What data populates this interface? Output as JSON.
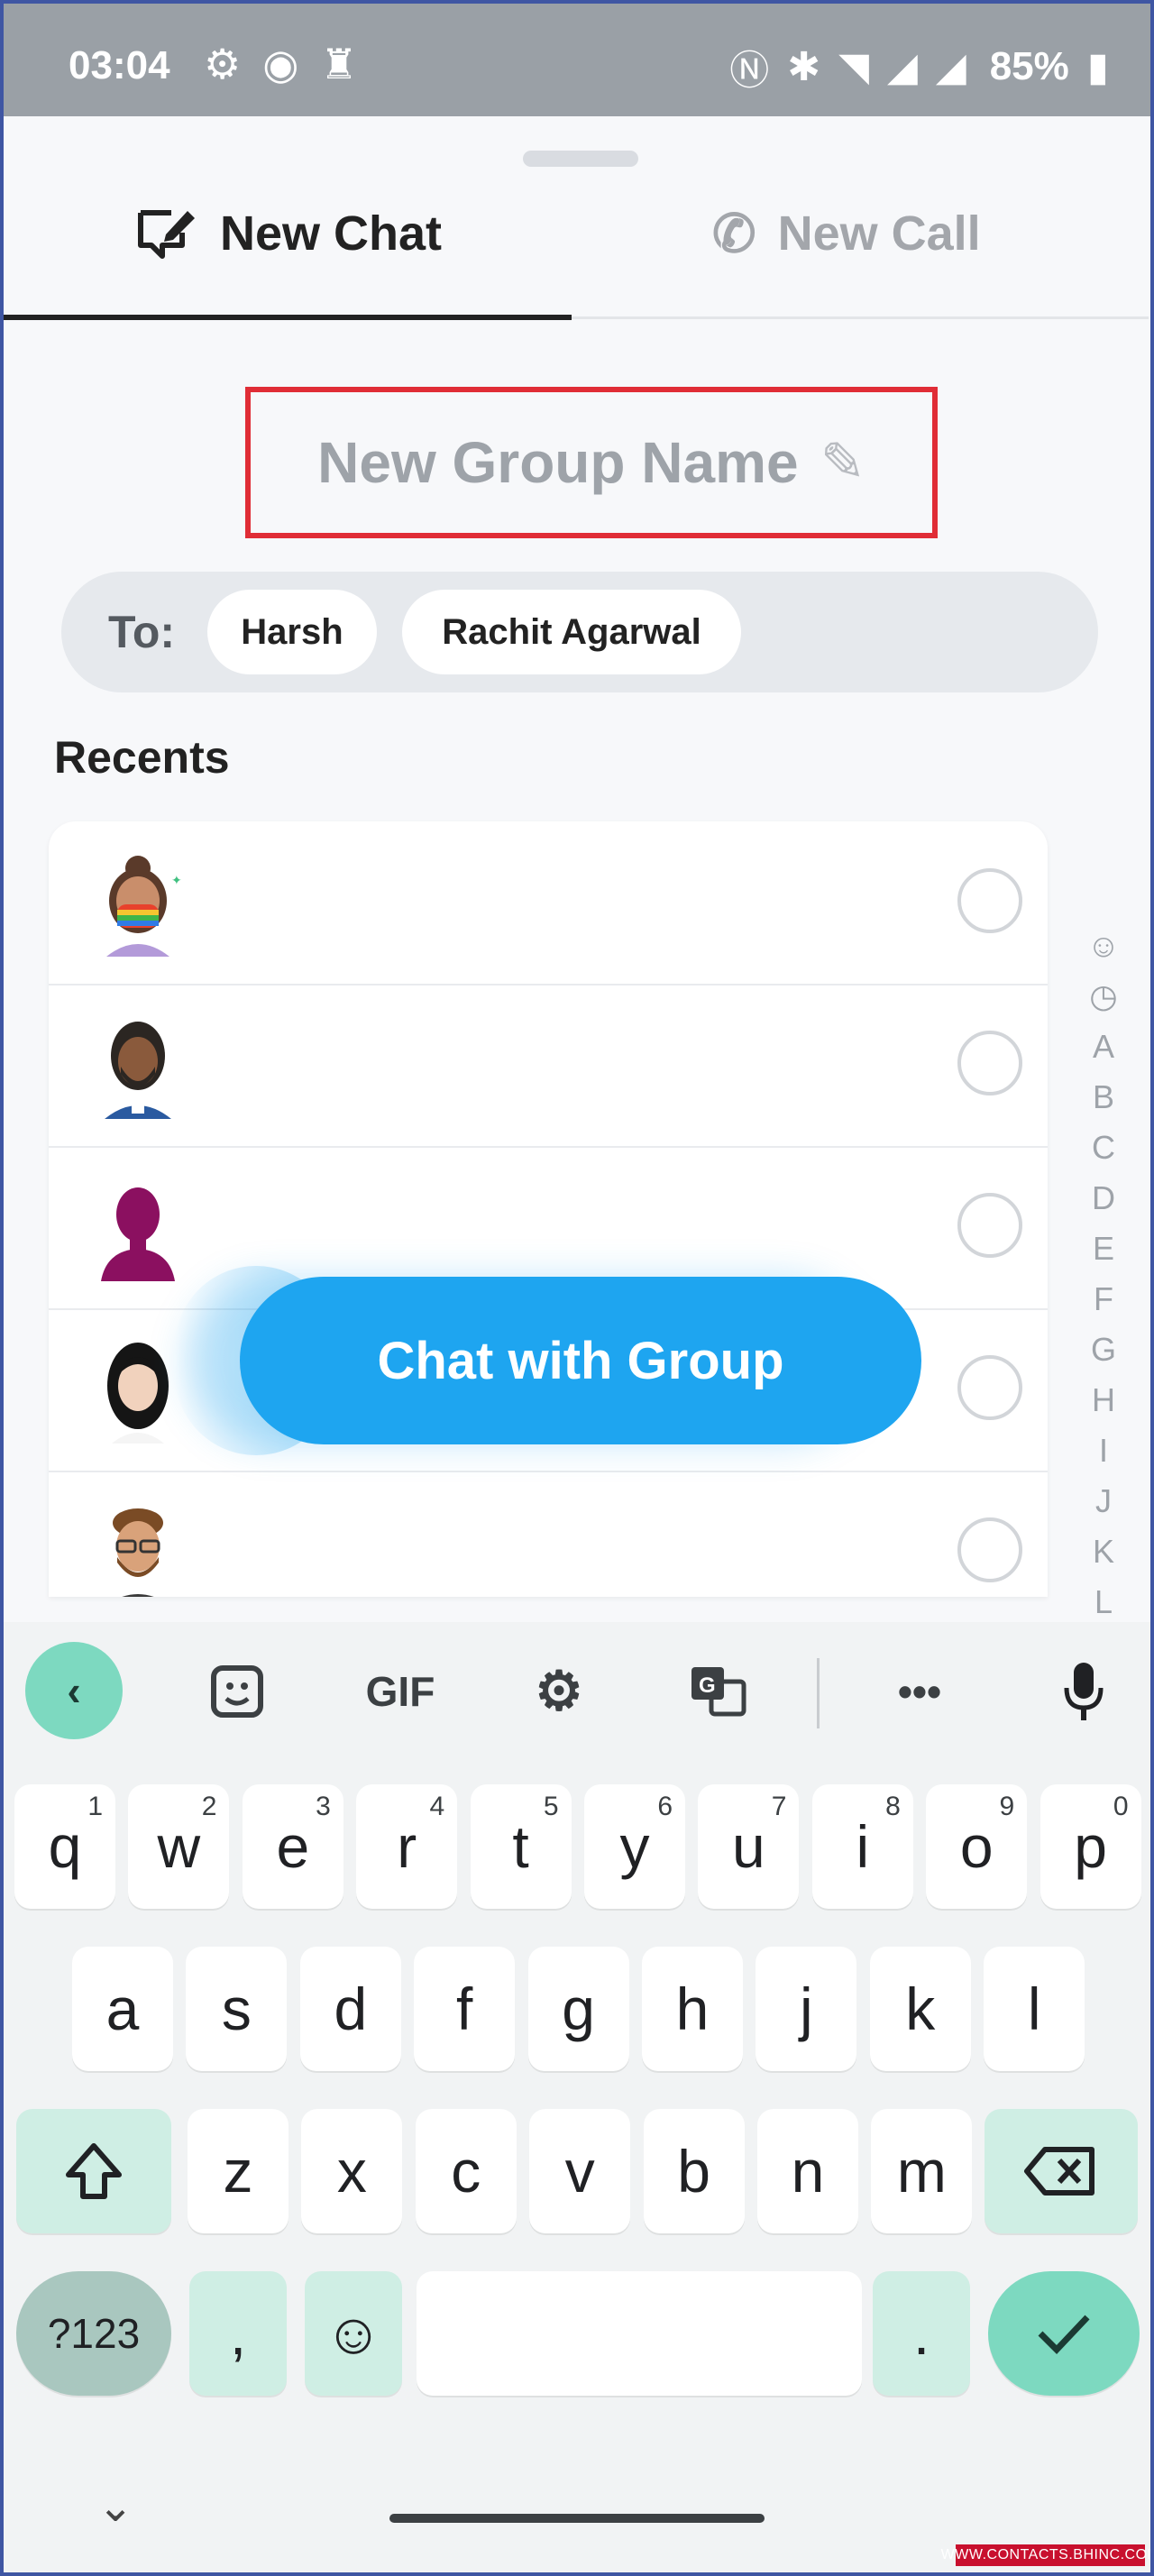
{
  "status_bar": {
    "time": "03:04",
    "battery": "85%"
  },
  "tabs": [
    {
      "label": "New Chat",
      "selected": true
    },
    {
      "label": "New Call",
      "selected": false
    }
  ],
  "group_name": {
    "placeholder": "New Group Name"
  },
  "to": {
    "label": "To:",
    "recipients": [
      "Harsh",
      "Rachit Agarwal"
    ]
  },
  "recents": {
    "title": "Recents"
  },
  "alphabet": [
    "☺",
    "◷",
    "A",
    "B",
    "C",
    "D",
    "E",
    "F",
    "G",
    "H",
    "I",
    "J",
    "K",
    "L"
  ],
  "fab": {
    "label": "Chat with Group"
  },
  "keyboard": {
    "toolbar": {
      "gif": "GIF"
    },
    "row1": [
      {
        "c": "q",
        "n": "1"
      },
      {
        "c": "w",
        "n": "2"
      },
      {
        "c": "e",
        "n": "3"
      },
      {
        "c": "r",
        "n": "4"
      },
      {
        "c": "t",
        "n": "5"
      },
      {
        "c": "y",
        "n": "6"
      },
      {
        "c": "u",
        "n": "7"
      },
      {
        "c": "i",
        "n": "8"
      },
      {
        "c": "o",
        "n": "9"
      },
      {
        "c": "p",
        "n": "0"
      }
    ],
    "row2": [
      "a",
      "s",
      "d",
      "f",
      "g",
      "h",
      "j",
      "k",
      "l"
    ],
    "row3": [
      "z",
      "x",
      "c",
      "v",
      "b",
      "n",
      "m"
    ],
    "symbols": "?123",
    "comma": ",",
    "period": "."
  },
  "watermark": "WWW.CONTACTS.BHINC.COM"
}
